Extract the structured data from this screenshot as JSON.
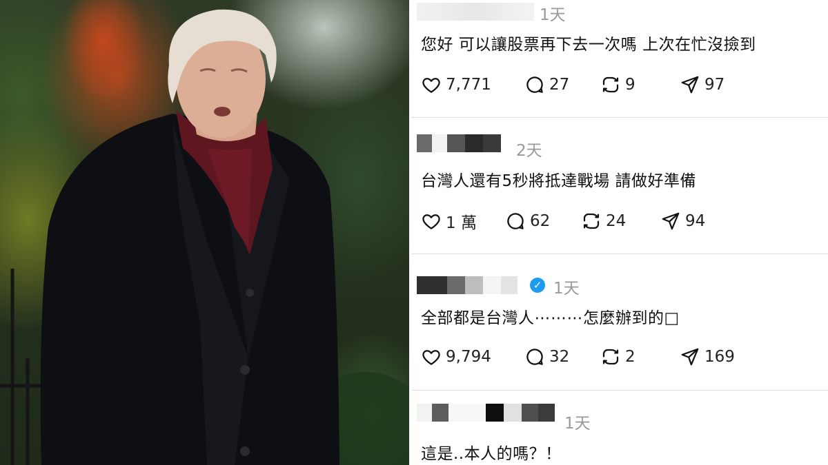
{
  "comments": [
    {
      "time": "1天",
      "text": "您好 可以讓股票再下去一次嗎 上次在忙沒撿到",
      "verified": false,
      "likes": "7,771",
      "replies": "27",
      "reposts": "9",
      "shares": "97"
    },
    {
      "time": "2天",
      "text": "台灣人還有5秒將抵達戰場 請做好準備",
      "verified": false,
      "likes": "1 萬",
      "replies": "62",
      "reposts": "24",
      "shares": "94"
    },
    {
      "time": "1天",
      "text": "全部都是台灣人⋯⋯⋯怎麼辦到的□",
      "verified": true,
      "likes": "9,794",
      "replies": "32",
      "reposts": "2",
      "shares": "169"
    },
    {
      "time": "1天",
      "text": "這是..本人的嗎？！",
      "verified": false
    }
  ],
  "icons": {
    "like": "heart-icon",
    "reply": "comment-icon",
    "repost": "repost-icon",
    "share": "send-icon",
    "verified": "verified-badge-icon"
  },
  "colors": {
    "verified": "#1d9bf0",
    "time": "#9a9a9a"
  }
}
